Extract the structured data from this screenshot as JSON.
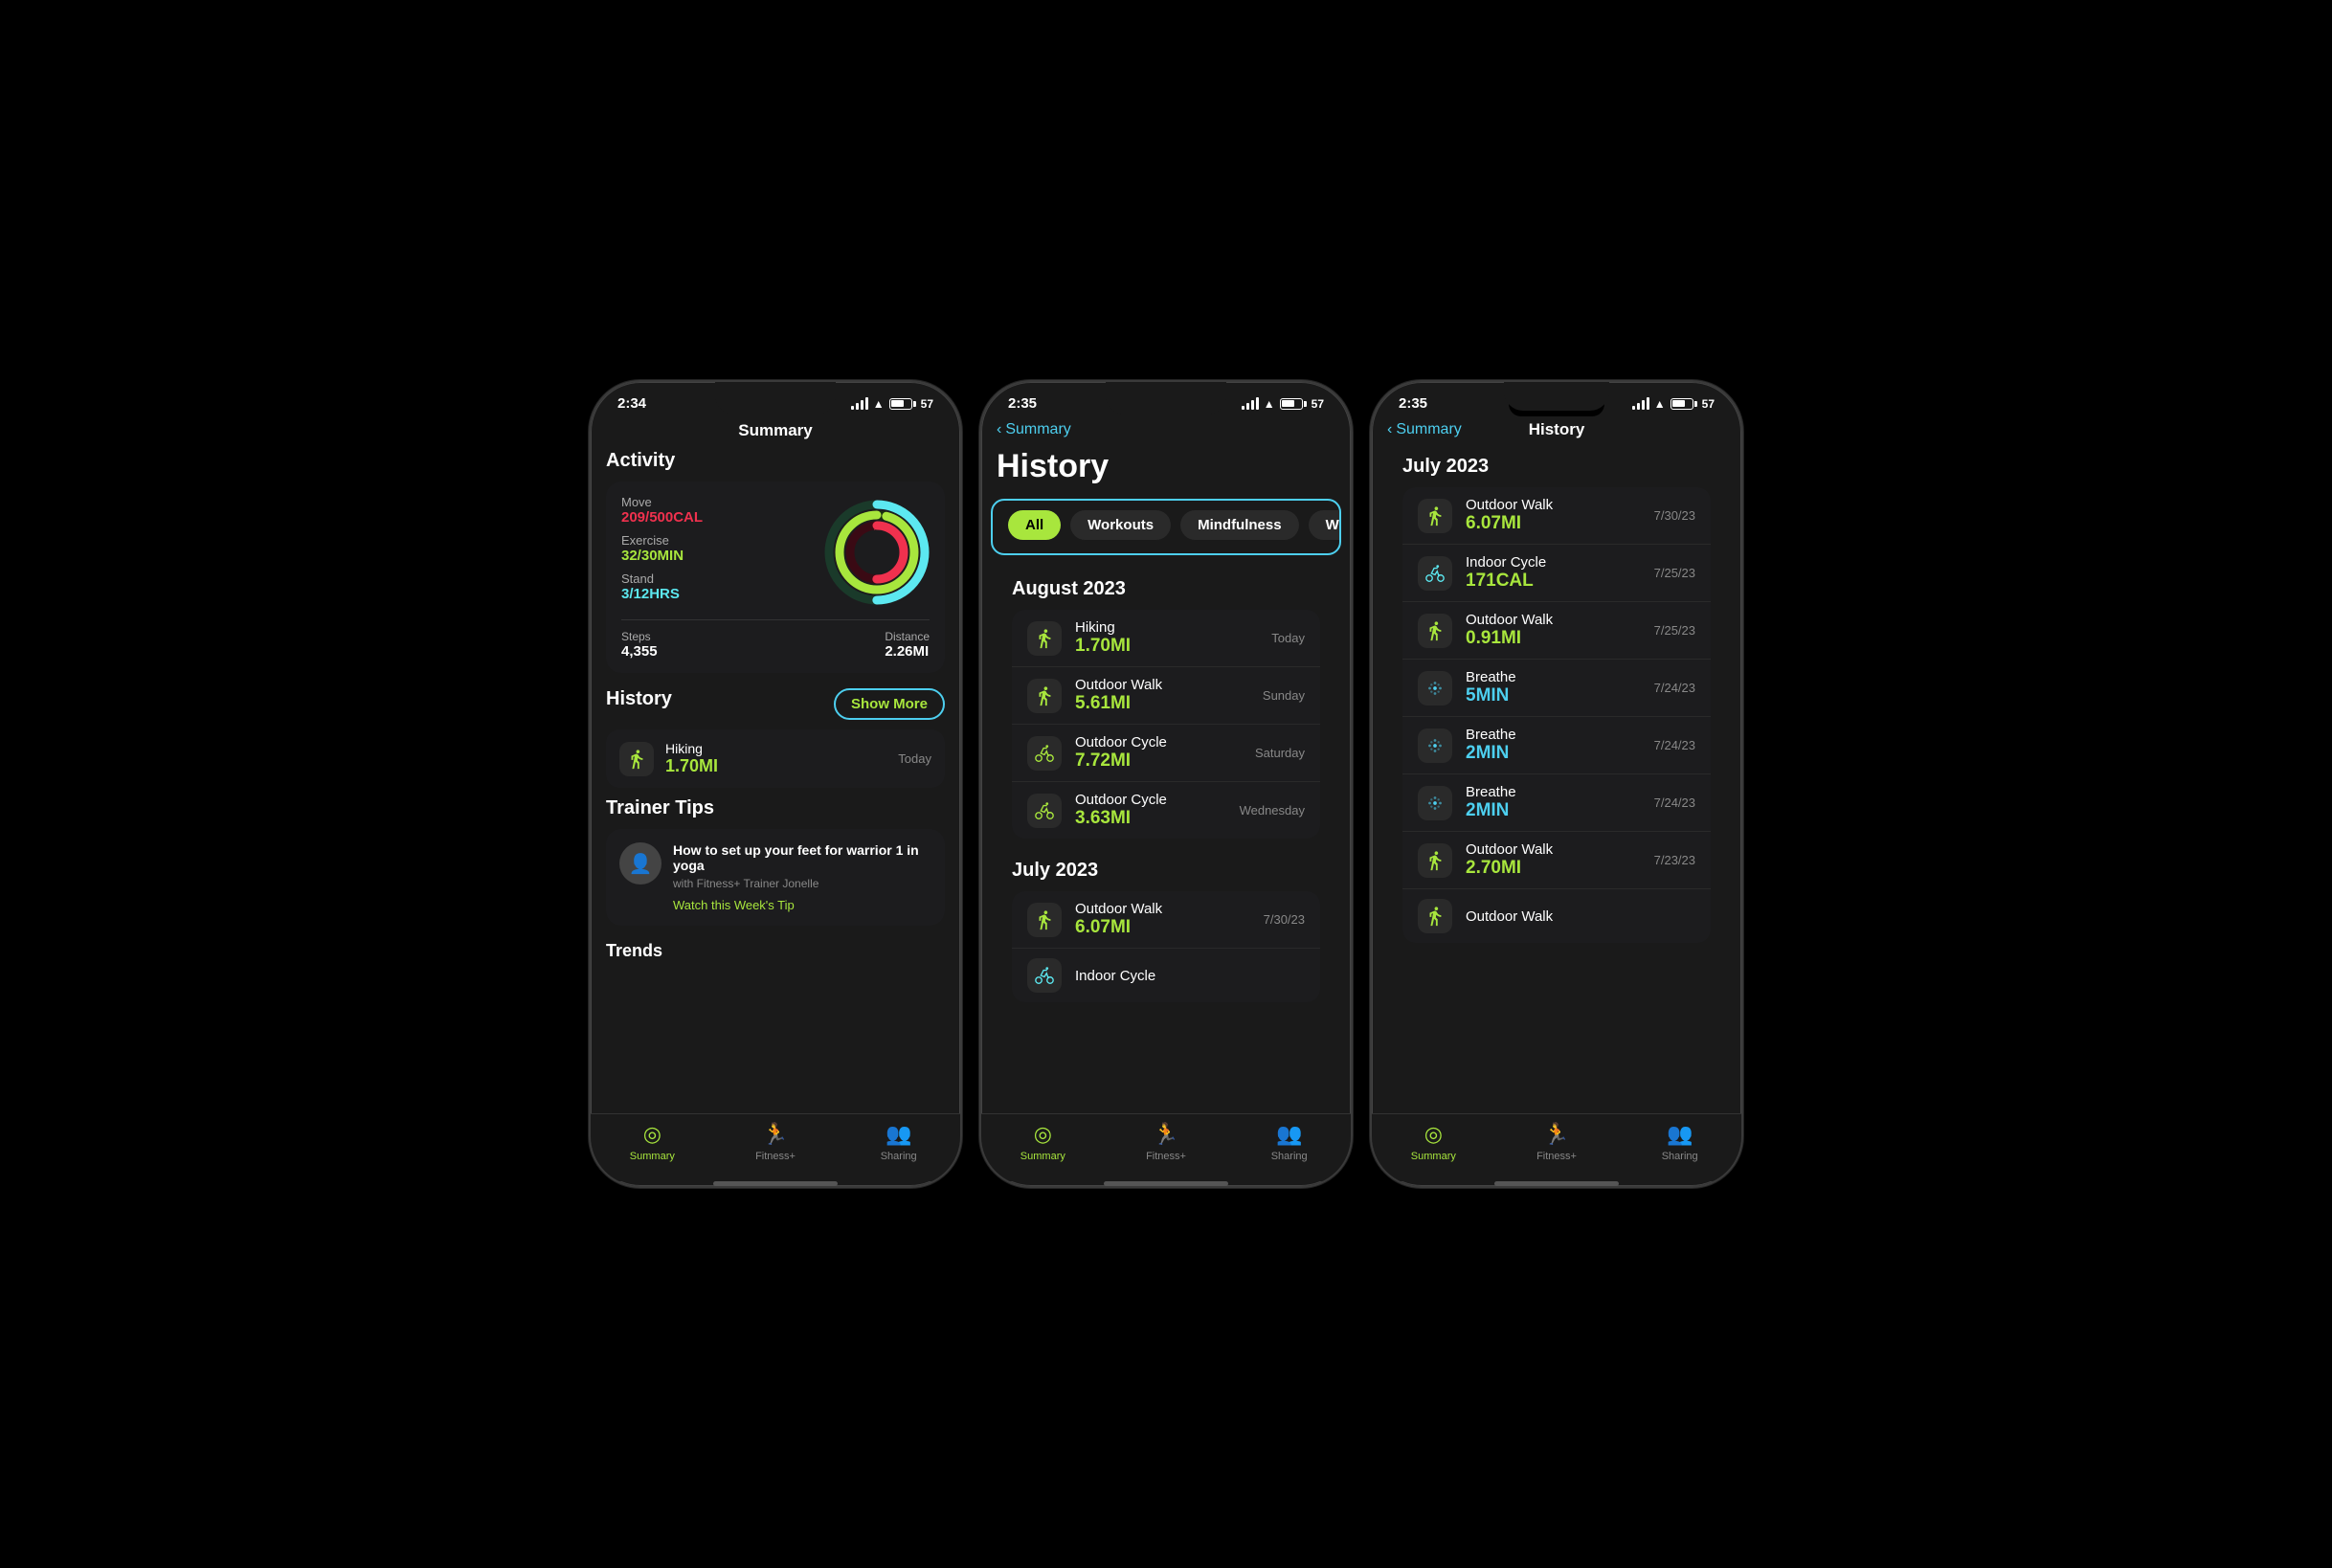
{
  "colors": {
    "accent_green": "#a8e63d",
    "accent_blue": "#4dcfef",
    "accent_red": "#f0314e",
    "bg_card": "#1c1c1e",
    "bg_phone": "#1a1a1a"
  },
  "phone1": {
    "status_time": "2:34",
    "page_title": "Summary",
    "activity": {
      "section": "Activity",
      "move_label": "Move",
      "move_value": "209/500CAL",
      "exercise_label": "Exercise",
      "exercise_value": "32/30MIN",
      "stand_label": "Stand",
      "stand_value": "3/12HRS",
      "steps_label": "Steps",
      "steps_value": "4,355",
      "distance_label": "Distance",
      "distance_value": "2.26MI"
    },
    "history": {
      "section": "History",
      "show_more_label": "Show More",
      "item": {
        "name": "Hiking",
        "value": "1.70MI",
        "date": "Today"
      }
    },
    "trainer_tips": {
      "section": "Trainer Tips",
      "text": "How to set up your feet for warrior 1 in yoga",
      "author": "with Fitness+ Trainer Jonelle",
      "link": "Watch this Week's Tip"
    },
    "tabs": [
      {
        "label": "Summary",
        "active": true
      },
      {
        "label": "Fitness+",
        "active": false
      },
      {
        "label": "Sharing",
        "active": false
      }
    ]
  },
  "phone2": {
    "status_time": "2:35",
    "back_label": "Summary",
    "page_title": "",
    "history_title": "History",
    "filter_tabs": [
      {
        "label": "All",
        "active": true
      },
      {
        "label": "Workouts",
        "active": false
      },
      {
        "label": "Mindfulness",
        "active": false
      },
      {
        "label": "W",
        "active": false
      }
    ],
    "august": {
      "month": "August 2023",
      "items": [
        {
          "name": "Hiking",
          "value": "1.70MI",
          "date": "Today",
          "icon": "walk"
        },
        {
          "name": "Outdoor Walk",
          "value": "5.61MI",
          "date": "Sunday",
          "icon": "walk"
        },
        {
          "name": "Outdoor Cycle",
          "value": "7.72MI",
          "date": "Saturday",
          "icon": "cycle"
        },
        {
          "name": "Outdoor Cycle",
          "value": "3.63MI",
          "date": "Wednesday",
          "icon": "cycle"
        }
      ]
    },
    "july": {
      "month": "July 2023",
      "items": [
        {
          "name": "Outdoor Walk",
          "value": "6.07MI",
          "date": "7/30/23",
          "icon": "walk"
        },
        {
          "name": "Indoor Cycle",
          "value": "...",
          "date": "",
          "icon": "indoor"
        }
      ]
    },
    "tabs": [
      {
        "label": "Summary",
        "active": true
      },
      {
        "label": "Fitness+",
        "active": false
      },
      {
        "label": "Sharing",
        "active": false
      }
    ]
  },
  "phone3": {
    "status_time": "2:35",
    "back_label": "Summary",
    "page_title": "History",
    "july": {
      "month": "July 2023",
      "items": [
        {
          "name": "Outdoor Walk",
          "value": "6.07MI",
          "date": "7/30/23",
          "icon": "walk"
        },
        {
          "name": "Indoor Cycle",
          "value": "171CAL",
          "date": "7/25/23",
          "icon": "indoor"
        },
        {
          "name": "Outdoor Walk",
          "value": "0.91MI",
          "date": "7/25/23",
          "icon": "walk"
        },
        {
          "name": "Breathe",
          "value": "5MIN",
          "date": "7/24/23",
          "icon": "breathe"
        },
        {
          "name": "Breathe",
          "value": "2MIN",
          "date": "7/24/23",
          "icon": "breathe"
        },
        {
          "name": "Breathe",
          "value": "2MIN",
          "date": "7/24/23",
          "icon": "breathe"
        },
        {
          "name": "Outdoor Walk",
          "value": "2.70MI",
          "date": "7/23/23",
          "icon": "walk"
        },
        {
          "name": "Outdoor Walk",
          "value": "...",
          "date": "",
          "icon": "walk"
        }
      ]
    },
    "tabs": [
      {
        "label": "Summary",
        "active": true
      },
      {
        "label": "Fitness+",
        "active": false
      },
      {
        "label": "Sharing",
        "active": false
      }
    ]
  }
}
